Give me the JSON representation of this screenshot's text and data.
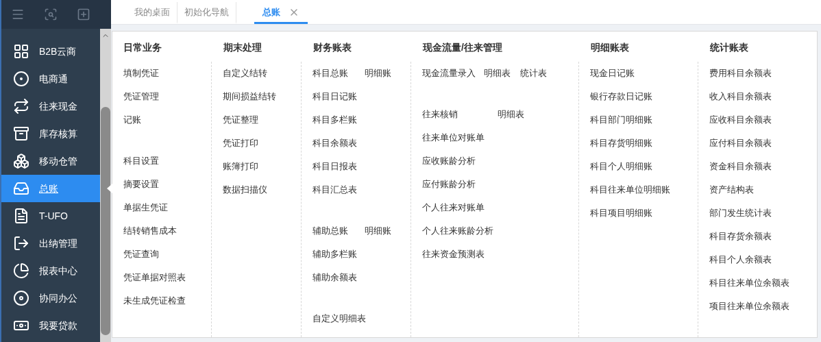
{
  "sidebar": {
    "items": [
      {
        "label": "B2B云商",
        "selected": false
      },
      {
        "label": "电商通",
        "selected": false
      },
      {
        "label": "往来现金",
        "selected": false
      },
      {
        "label": "库存核算",
        "selected": false
      },
      {
        "label": "移动仓管",
        "selected": false
      },
      {
        "label": "总账",
        "selected": true
      },
      {
        "label": "T-UFO",
        "selected": false
      },
      {
        "label": "出纳管理",
        "selected": false
      },
      {
        "label": "报表中心",
        "selected": false
      },
      {
        "label": "协同办公",
        "selected": false
      },
      {
        "label": "我要贷款",
        "selected": false
      }
    ]
  },
  "tabs": [
    {
      "label": "我的桌面",
      "selected": false,
      "closable": false
    },
    {
      "label": "初始化导航",
      "selected": false,
      "closable": false
    },
    {
      "label": "总账",
      "selected": true,
      "closable": true
    }
  ],
  "menu_columns": [
    {
      "title": "日常业务",
      "groups": [
        [
          [
            "填制凭证"
          ],
          [
            "凭证管理"
          ],
          [
            "记账"
          ]
        ],
        [
          [
            "科目设置"
          ],
          [
            "摘要设置"
          ],
          [
            "单据生凭证"
          ],
          [
            "结转销售成本"
          ],
          [
            "凭证查询"
          ],
          [
            "凭证单据对照表"
          ],
          [
            "未生成凭证检查"
          ]
        ]
      ]
    },
    {
      "title": "期末处理",
      "groups": [
        [
          [
            "自定义结转"
          ],
          [
            "期间损益结转"
          ],
          [
            "凭证整理"
          ],
          [
            "凭证打印"
          ],
          [
            "账簿打印"
          ],
          [
            "数据扫描仪"
          ]
        ]
      ]
    },
    {
      "title": "财务账表",
      "groups": [
        [
          [
            "科目总账",
            "明细账"
          ],
          [
            "科目日记账"
          ],
          [
            "科目多栏账"
          ],
          [
            "科目余额表"
          ],
          [
            "科目日报表"
          ],
          [
            "科目汇总表"
          ]
        ],
        [
          [
            "辅助总账",
            "明细账"
          ],
          [
            "辅助多栏账"
          ],
          [
            "辅助余额表"
          ]
        ],
        [
          [
            "自定义明细表"
          ]
        ]
      ]
    },
    {
      "title": "现金流量/往来管理",
      "groups": [
        [
          [
            "现金流量录入",
            "明细表",
            "统计表"
          ]
        ],
        [
          [
            "往来核销",
            "明细表"
          ],
          [
            "往来单位对账单"
          ],
          [
            "应收账龄分析"
          ],
          [
            "应付账龄分析"
          ],
          [
            "个人往来对账单"
          ],
          [
            "个人往来账龄分析"
          ],
          [
            "往来资金预测表"
          ]
        ]
      ]
    },
    {
      "title": "明细账表",
      "groups": [
        [
          [
            "现金日记账"
          ],
          [
            "银行存款日记账"
          ],
          [
            "科目部门明细账"
          ],
          [
            "科目存货明细账"
          ],
          [
            "科目个人明细账"
          ],
          [
            "科目往来单位明细账"
          ],
          [
            "科目项目明细账"
          ]
        ]
      ]
    },
    {
      "title": "统计账表",
      "groups": [
        [
          [
            "费用科目余额表"
          ],
          [
            "收入科目余额表"
          ],
          [
            "应收科目余额表"
          ],
          [
            "应付科目余额表"
          ],
          [
            "资金科目余额表"
          ],
          [
            "资产结构表"
          ],
          [
            "部门发生统计表"
          ],
          [
            "科目存货余额表"
          ],
          [
            "科目个人余额表"
          ],
          [
            "科目往来单位余额表"
          ],
          [
            "项目往来单位余额表"
          ]
        ]
      ]
    }
  ]
}
